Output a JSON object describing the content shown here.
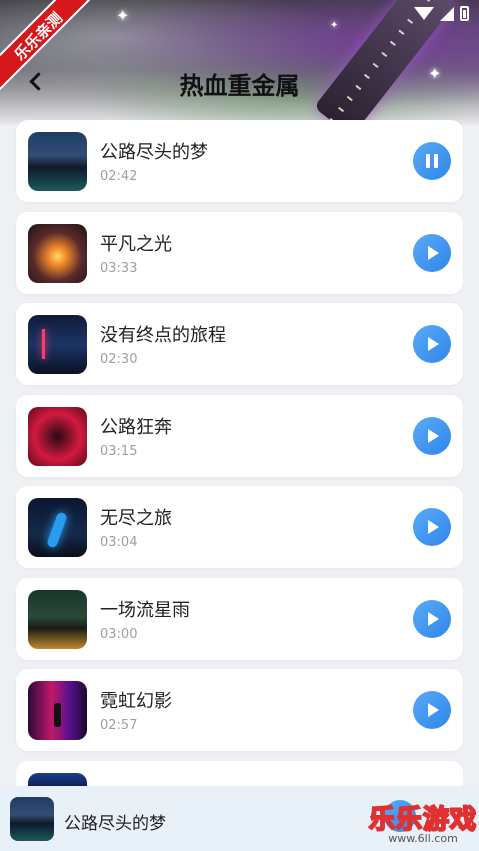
{
  "header": {
    "title": "热血重金属",
    "back_icon": "chevron-left-icon"
  },
  "watermark": {
    "ribbon_text": "乐乐亲测",
    "brand_text": "乐乐游戏",
    "url_text": "www.6ll.com"
  },
  "status_bar": {
    "icons": [
      "wifi-icon",
      "signal-icon",
      "battery-icon"
    ]
  },
  "songs": [
    {
      "title": "公路尽头的梦",
      "duration": "02:42",
      "state": "playing",
      "cover": "night-highway-cover"
    },
    {
      "title": "平凡之光",
      "duration": "03:33",
      "state": "paused",
      "cover": "sunset-road-cover"
    },
    {
      "title": "没有终点的旅程",
      "duration": "02:30",
      "state": "paused",
      "cover": "neon-road-cover"
    },
    {
      "title": "公路狂奔",
      "duration": "03:15",
      "state": "paused",
      "cover": "red-tunnel-cover"
    },
    {
      "title": "无尽之旅",
      "duration": "03:04",
      "state": "paused",
      "cover": "blue-light-cover"
    },
    {
      "title": "一场流星雨",
      "duration": "03:00",
      "state": "paused",
      "cover": "meteor-city-cover"
    },
    {
      "title": "霓虹幻影",
      "duration": "02:57",
      "state": "paused",
      "cover": "neon-alley-cover"
    }
  ],
  "mini_player": {
    "title": "公路尽头的梦"
  },
  "colors": {
    "accent": "#2f86ec",
    "card_bg": "#ffffff",
    "page_bg": "#eef0f3",
    "mini_player_bg": "#e8f0f8"
  }
}
